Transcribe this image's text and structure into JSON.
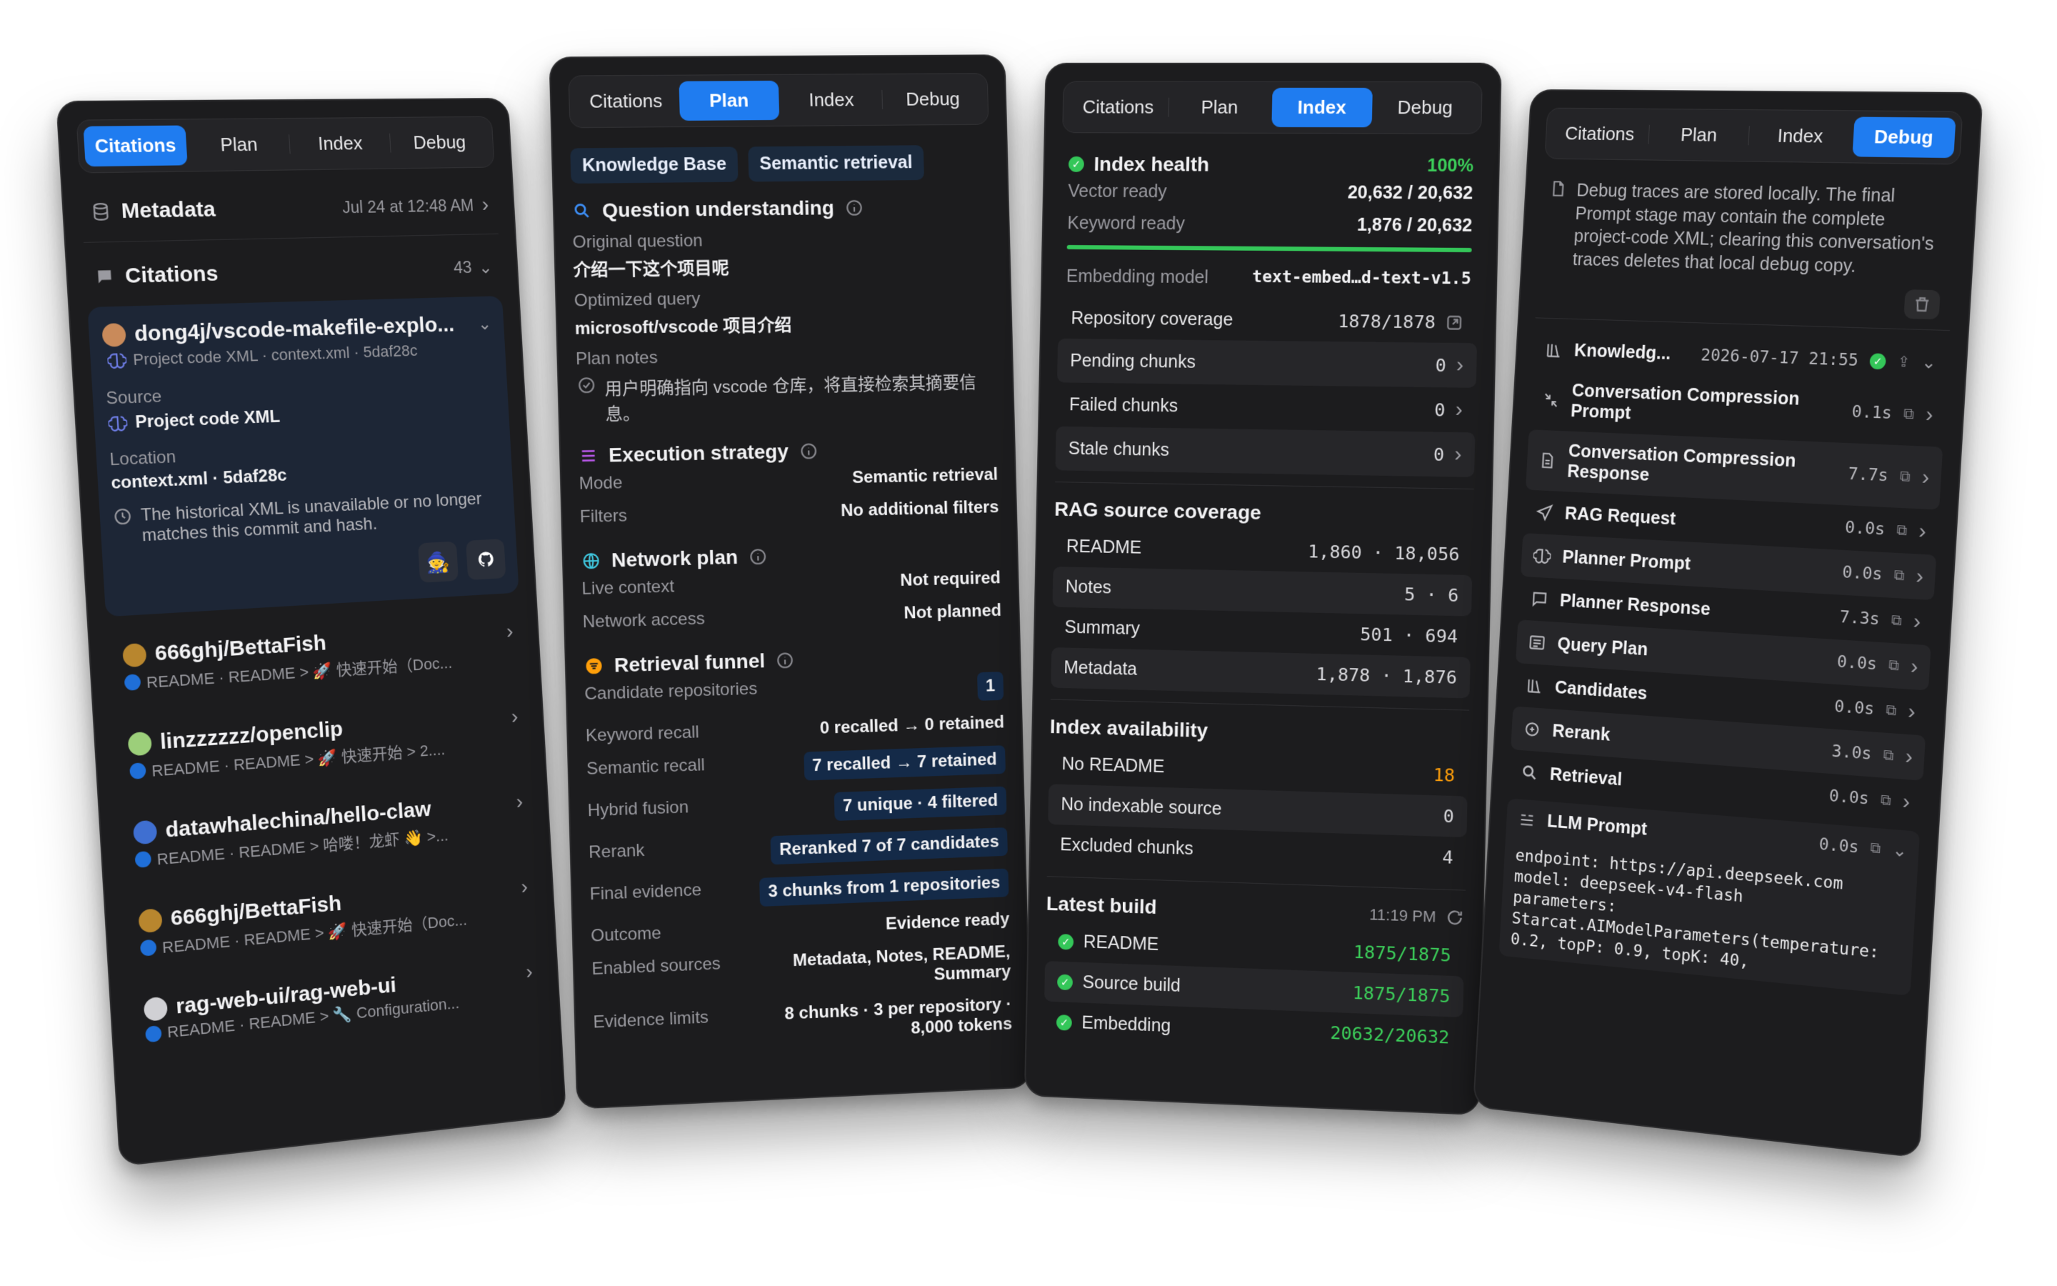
{
  "tabs": [
    "Citations",
    "Plan",
    "Index",
    "Debug"
  ],
  "colors": {
    "accent": "#1f7cf0",
    "success": "#34c759",
    "warning": "#ff9f0a",
    "panel": "#1c1c1e"
  },
  "citations_panel": {
    "metadata_title": "Metadata",
    "metadata_time": "Jul 24 at 12:48 AM",
    "citations_title": "Citations",
    "citations_count": "43",
    "expanded": {
      "name": "dong4j/vscode-makefile-explo...",
      "subtitle": "Project code XML · context.xml · 5daf28c",
      "source_label": "Source",
      "source_value": "Project code XML",
      "location_label": "Location",
      "location_value": "context.xml · 5daf28c",
      "warning": "The historical XML is unavailable or no longer matches this commit and hash."
    },
    "items": [
      {
        "name": "666ghj/BettaFish",
        "sub": "README · README > 🚀 快速开始（Doc..."
      },
      {
        "name": "linzzzzzz/openclip",
        "sub": "README · README > 🚀 快速开始 > 2...."
      },
      {
        "name": "datawhalechina/hello-claw",
        "sub": "README · README > 哈喽！龙虾 👋 >..."
      },
      {
        "name": "666ghj/BettaFish",
        "sub": "README · README > 🚀 快速开始（Doc..."
      },
      {
        "name": "rag-web-ui/rag-web-ui",
        "sub": "README · README > 🔧 Configuration..."
      }
    ]
  },
  "plan_panel": {
    "chips": [
      "Knowledge Base",
      "Semantic retrieval"
    ],
    "question_title": "Question understanding",
    "original_label": "Original question",
    "original_value": "介绍一下这个项目呢",
    "optimized_label": "Optimized query",
    "optimized_value": "microsoft/vscode 项目介绍",
    "notes_label": "Plan notes",
    "notes_value": "用户明确指向 vscode 仓库，将直接检索其摘要信息。",
    "execution_title": "Execution strategy",
    "mode_label": "Mode",
    "mode_value": "Semantic retrieval",
    "filters_label": "Filters",
    "filters_value": "No additional filters",
    "network_title": "Network plan",
    "live_label": "Live context",
    "live_value": "Not required",
    "access_label": "Network access",
    "access_value": "Not planned",
    "funnel_title": "Retrieval funnel",
    "candidate_label": "Candidate repositories",
    "candidate_value": "1",
    "keyword_label": "Keyword recall",
    "keyword_value": "0 recalled → 0 retained",
    "semantic_label": "Semantic recall",
    "semantic_value": "7 recalled → 7 retained",
    "hybrid_label": "Hybrid fusion",
    "hybrid_value": "7 unique · 4 filtered",
    "rerank_label": "Rerank",
    "rerank_value": "Reranked 7 of 7 candidates",
    "final_label": "Final evidence",
    "final_value": "3 chunks from 1 repositories",
    "outcome_label": "Outcome",
    "outcome_value": "Evidence ready",
    "sources_label": "Enabled sources",
    "sources_value": "Metadata, Notes, README, Summary",
    "limits_label": "Evidence limits",
    "limits_value": "8 chunks · 3 per repository · 8,000 tokens"
  },
  "index_panel": {
    "health_title": "Index health",
    "health_pct": "100%",
    "health_fraction": 1.0,
    "vector_label": "Vector ready",
    "vector_value": "20,632 / 20,632",
    "keyword_label": "Keyword ready",
    "keyword_value": "1,876 / 20,632",
    "embed_label": "Embedding model",
    "embed_value": "text-embed…d-text-v1.5",
    "coverage_label": "Repository coverage",
    "coverage_value": "1878/1878",
    "pending_label": "Pending chunks",
    "pending_value": "0",
    "failed_label": "Failed chunks",
    "failed_value": "0",
    "stale_label": "Stale chunks",
    "stale_value": "0",
    "rag_title": "RAG source coverage",
    "rag_rows": [
      {
        "label": "README",
        "value": "1,860 · 18,056"
      },
      {
        "label": "Notes",
        "value": "5 · 6"
      },
      {
        "label": "Summary",
        "value": "501 · 694"
      },
      {
        "label": "Metadata",
        "value": "1,878 · 1,876"
      }
    ],
    "avail_title": "Index availability",
    "avail_rows": [
      {
        "label": "No README",
        "value": "18"
      },
      {
        "label": "No indexable source",
        "value": "0"
      },
      {
        "label": "Excluded chunks",
        "value": "4"
      }
    ],
    "build_title": "Latest build",
    "build_time": "11:19 PM",
    "build_rows": [
      {
        "label": "README",
        "value": "1875/1875"
      },
      {
        "label": "Source build",
        "value": "1875/1875"
      },
      {
        "label": "Embedding",
        "value": "20632/20632"
      }
    ]
  },
  "debug_panel": {
    "note": "Debug traces are stored locally. The final Prompt stage may contain the complete project-code XML; clearing this conversation's traces deletes that local debug copy.",
    "header_name": "Knowledg...",
    "header_time": "2026-07-17 21:55",
    "steps": [
      {
        "name": "Conversation Compression Prompt",
        "time": "0.1s",
        "icon": "compress-icon"
      },
      {
        "name": "Conversation Compression Response",
        "time": "7.7s",
        "icon": "document-icon"
      },
      {
        "name": "RAG Request",
        "time": "0.0s",
        "icon": "send-icon"
      },
      {
        "name": "Planner Prompt",
        "time": "0.0s",
        "icon": "brain-icon"
      },
      {
        "name": "Planner Response",
        "time": "7.3s",
        "icon": "message-icon"
      },
      {
        "name": "Query Plan",
        "time": "0.0s",
        "icon": "list-icon"
      },
      {
        "name": "Candidates",
        "time": "0.0s",
        "icon": "books-icon"
      },
      {
        "name": "Rerank",
        "time": "3.0s",
        "icon": "rerank-icon"
      },
      {
        "name": "Retrieval",
        "time": "0.0s",
        "icon": "search-icon"
      }
    ],
    "llm_title": "LLM Prompt",
    "llm_time": "0.0s",
    "llm_code": "endpoint: https://api.deepseek.com\nmodel: deepseek-v4-flash\nparameters:\nStarcat.AIModelParameters(temperature:\n0.2, topP: 0.9, topK: 40,"
  }
}
